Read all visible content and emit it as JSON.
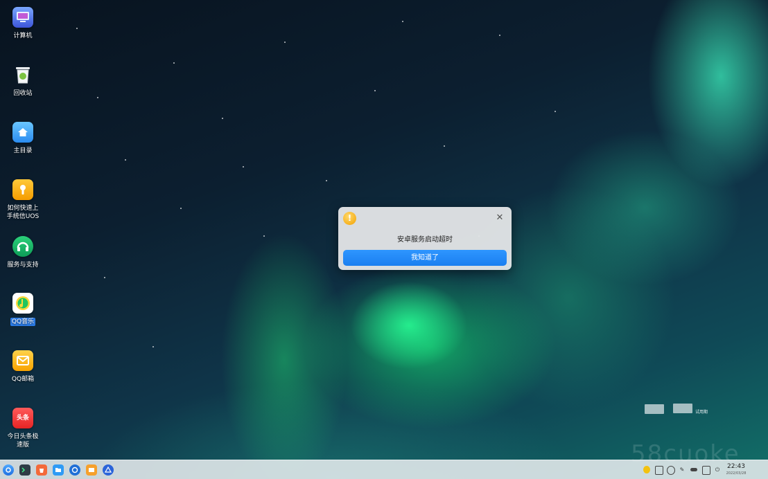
{
  "desktop": {
    "icons": [
      {
        "label": "计算机",
        "icon": "computer-icon"
      },
      {
        "label": "回收站",
        "icon": "trash-icon"
      },
      {
        "label": "主目录",
        "icon": "home-folder-icon"
      },
      {
        "label": "如何快速上\n手统信UOS",
        "icon": "help-book-icon"
      },
      {
        "label": "服务与支持",
        "icon": "support-icon"
      },
      {
        "label": "QQ音乐",
        "icon": "qq-music-icon"
      },
      {
        "label": "QQ邮箱",
        "icon": "qq-mail-icon"
      },
      {
        "label": "今日头条极\n速版",
        "icon": "toutiao-icon"
      }
    ],
    "right_note": "试用期"
  },
  "dialog": {
    "icon": "warning-icon",
    "message": "安卓服务启动超时",
    "button_label": "我知道了",
    "close_icon": "close-icon"
  },
  "watermark": "58cuoke",
  "taskbar": {
    "launcher_icon": "launcher-icon",
    "apps": [
      "terminal-icon",
      "app-store-icon",
      "file-manager-icon",
      "browser-icon",
      "mail-icon",
      "settings-icon"
    ],
    "tray": [
      "ime-icon",
      "clipboard-icon",
      "notification-icon",
      "pen-icon",
      "network-icon",
      "display-icon",
      "power-icon"
    ],
    "clock": {
      "time": "22:43",
      "date": "2022/03/28"
    }
  },
  "colors": {
    "accent": "#1a7ff0",
    "warning": "#f2a100"
  }
}
